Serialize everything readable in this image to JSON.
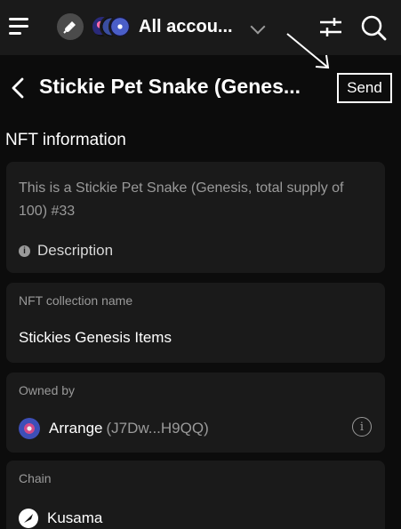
{
  "topbar": {
    "account_label": "All accou...",
    "icons": [
      "menu-icon",
      "plug-icon",
      "account-avatars",
      "chevron-down-icon",
      "filter-sliders-icon",
      "search-icon"
    ]
  },
  "header": {
    "back_icon": "chevron-left-icon",
    "title": "Stickie Pet Snake (Genes...",
    "send_label": "Send"
  },
  "nft_section": {
    "title": "NFT information",
    "description_text": "This is a Stickie Pet Snake (Genesis, total supply of 100) #33",
    "description_link": "Description"
  },
  "collection": {
    "label": "NFT collection name",
    "value": "Stickies Genesis Items"
  },
  "owner": {
    "label": "Owned by",
    "name": "Arrange",
    "address": "(J7Dw...H9QQ)"
  },
  "chain": {
    "label": "Chain",
    "value": "Kusama"
  },
  "colors": {
    "background": "#0c0c0c",
    "card": "#1a1a1a",
    "muted_text": "#9a9a9a",
    "text": "#ffffff"
  }
}
